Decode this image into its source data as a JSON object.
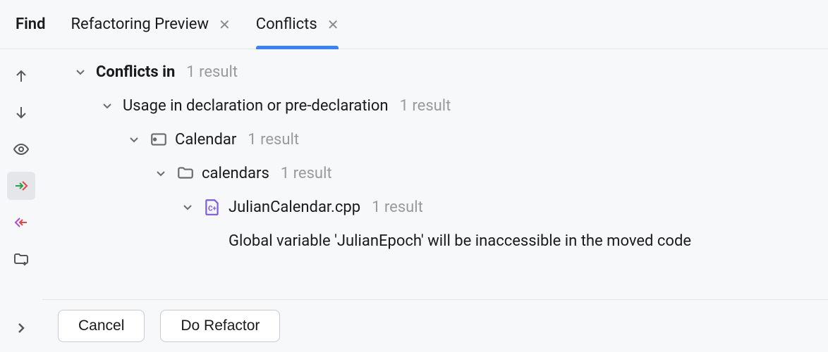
{
  "tabs": {
    "find": "Find",
    "refactoring_preview": "Refactoring Preview",
    "conflicts": "Conflicts"
  },
  "tree": {
    "root": {
      "label": "Conflicts in",
      "count": "1 result"
    },
    "usage": {
      "label": "Usage in declaration or pre-declaration",
      "count": "1 result"
    },
    "module": {
      "label": "Calendar",
      "count": "1 result"
    },
    "folder": {
      "label": "calendars",
      "count": "1 result"
    },
    "file": {
      "label": "JulianCalendar.cpp",
      "count": "1 result"
    },
    "message": "Global variable 'JulianEpoch' will be inaccessible in the moved code"
  },
  "footer": {
    "cancel": "Cancel",
    "do_refactor": "Do Refactor"
  }
}
